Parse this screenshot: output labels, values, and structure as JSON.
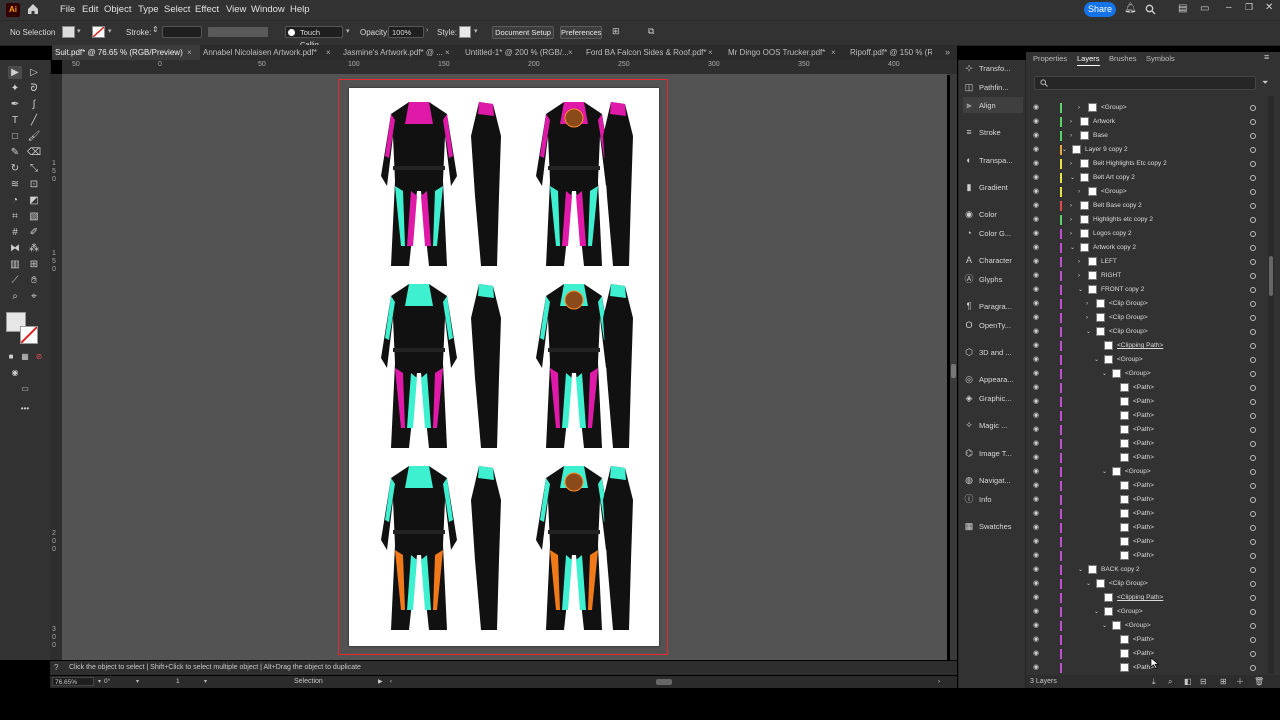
{
  "menu": [
    "File",
    "Edit",
    "Object",
    "Type",
    "Select",
    "Effect",
    "View",
    "Window",
    "Help"
  ],
  "app_logo": "Ai",
  "share_label": "Share",
  "control": {
    "selection": "No Selection",
    "stroke_label": "Stroke:",
    "brush": "Touch Callig...",
    "opacity_label": "Opacity:",
    "opacity_value": "100%",
    "style_label": "Style:",
    "doc_setup": "Document Setup",
    "preferences": "Preferences"
  },
  "tabs": [
    {
      "label": "Suit.pdf* @ 76.65 % (RGB/Preview)"
    },
    {
      "label": "Annabel Nicolaisen Artwork.pdf*"
    },
    {
      "label": "Jasmine's Artwork.pdf* @ ..."
    },
    {
      "label": "Untitled-1* @ 200 % (RGB/..."
    },
    {
      "label": "Ford BA Falcon Sides & Roof.pdf*"
    },
    {
      "label": "Mr Dingo OOS Trucker.pdf*"
    },
    {
      "label": "Ripoff.pdf* @ 150 % (R"
    }
  ],
  "ruler_top": [
    "50",
    "0",
    "50",
    "100",
    "150",
    "200",
    "250",
    "300",
    "350",
    "400",
    "450"
  ],
  "ruler_left": [
    "1",
    "5",
    "0",
    "1",
    "5",
    "0",
    "2",
    "0",
    "0",
    "2",
    "5",
    "0",
    "3",
    "0",
    "0"
  ],
  "status_hint": "Click the object to select  |  Shift+Click to select multiple object  |  Alt+Drag the object to duplicate",
  "bottom": {
    "zoom": "76.65%",
    "rotation": "0°",
    "artboard": "1",
    "mode": "Selection"
  },
  "side_panels": [
    {
      "label": "Transfo...",
      "icon": "transform-icon"
    },
    {
      "label": "Pathfin...",
      "icon": "pathfinder-icon"
    },
    {
      "label": "Align",
      "icon": "align-icon"
    },
    {
      "label": "Stroke",
      "icon": "stroke-icon"
    },
    {
      "label": "Transpa...",
      "icon": "transparency-icon"
    },
    {
      "label": "Gradient",
      "icon": "gradient-icon"
    },
    {
      "label": "Color",
      "icon": "color-icon"
    },
    {
      "label": "Color G...",
      "icon": "color-guide-icon"
    },
    {
      "label": "Character",
      "icon": "character-icon"
    },
    {
      "label": "Glyphs",
      "icon": "glyphs-icon"
    },
    {
      "label": "Paragra...",
      "icon": "paragraph-icon"
    },
    {
      "label": "OpenTy...",
      "icon": "opentype-icon"
    },
    {
      "label": "3D and ...",
      "icon": "3d-icon"
    },
    {
      "label": "Appeara...",
      "icon": "appearance-icon"
    },
    {
      "label": "Graphic...",
      "icon": "graphic-styles-icon"
    },
    {
      "label": "Magic ...",
      "icon": "magic-wand-icon"
    },
    {
      "label": "Image T...",
      "icon": "image-trace-icon"
    },
    {
      "label": "Navigat...",
      "icon": "navigator-icon"
    },
    {
      "label": "Info",
      "icon": "info-icon"
    },
    {
      "label": "Swatches",
      "icon": "swatches-icon"
    }
  ],
  "panel_tabs": [
    "Properties",
    "Layers",
    "Brushes",
    "Symbols"
  ],
  "layers": [
    {
      "name": "<Group>",
      "indent": 5,
      "chev": ">",
      "color": "#5ad266"
    },
    {
      "name": "Artwork",
      "indent": 4,
      "chev": ">",
      "color": "#5ad266"
    },
    {
      "name": "Base",
      "indent": 4,
      "chev": ">",
      "color": "#5ad266"
    },
    {
      "name": "Layer 9 copy 2",
      "indent": 3,
      "chev": "v",
      "color": "#e8a642"
    },
    {
      "name": "Belt Highlights Etc copy 2",
      "indent": 4,
      "chev": ">",
      "color": "#e8e24a"
    },
    {
      "name": "Belt Art copy 2",
      "indent": 4,
      "chev": "v",
      "color": "#e8e24a"
    },
    {
      "name": "<Group>",
      "indent": 5,
      "chev": ">",
      "color": "#e8e24a"
    },
    {
      "name": "Belt Base copy 2",
      "indent": 4,
      "chev": ">",
      "color": "#e04a4a"
    },
    {
      "name": "Highlights etc copy 2",
      "indent": 4,
      "chev": ">",
      "color": "#5ad266"
    },
    {
      "name": "Logos copy 2",
      "indent": 4,
      "chev": ">",
      "color": "#c050d0"
    },
    {
      "name": "Artwork copy 2",
      "indent": 4,
      "chev": "v",
      "color": "#c050d0"
    },
    {
      "name": "LEFT",
      "indent": 5,
      "chev": ">",
      "color": "#c050d0"
    },
    {
      "name": "RIGHT",
      "indent": 5,
      "chev": ">",
      "color": "#c050d0"
    },
    {
      "name": "FRONT copy 2",
      "indent": 5,
      "chev": "v",
      "color": "#c050d0"
    },
    {
      "name": "<Clip Group>",
      "indent": 6,
      "chev": ">",
      "color": "#c050d0"
    },
    {
      "name": "<Clip Group>",
      "indent": 6,
      "chev": ">",
      "color": "#c050d0"
    },
    {
      "name": "<Clip Group>",
      "indent": 6,
      "chev": "v",
      "color": "#c050d0"
    },
    {
      "name": "<Clipping Path>",
      "indent": 7,
      "chev": "",
      "color": "#c050d0",
      "u": true
    },
    {
      "name": "<Group>",
      "indent": 7,
      "chev": "v",
      "color": "#c050d0"
    },
    {
      "name": "<Group>",
      "indent": 8,
      "chev": "v",
      "color": "#c050d0"
    },
    {
      "name": "<Path>",
      "indent": 9,
      "chev": "",
      "color": "#c050d0"
    },
    {
      "name": "<Path>",
      "indent": 9,
      "chev": "",
      "color": "#c050d0"
    },
    {
      "name": "<Path>",
      "indent": 9,
      "chev": "",
      "color": "#c050d0"
    },
    {
      "name": "<Path>",
      "indent": 9,
      "chev": "",
      "color": "#c050d0"
    },
    {
      "name": "<Path>",
      "indent": 9,
      "chev": "",
      "color": "#c050d0"
    },
    {
      "name": "<Path>",
      "indent": 9,
      "chev": "",
      "color": "#c050d0"
    },
    {
      "name": "<Group>",
      "indent": 8,
      "chev": "v",
      "color": "#c050d0"
    },
    {
      "name": "<Path>",
      "indent": 9,
      "chev": "",
      "color": "#c050d0"
    },
    {
      "name": "<Path>",
      "indent": 9,
      "chev": "",
      "color": "#c050d0"
    },
    {
      "name": "<Path>",
      "indent": 9,
      "chev": "",
      "color": "#c050d0"
    },
    {
      "name": "<Path>",
      "indent": 9,
      "chev": "",
      "color": "#c050d0"
    },
    {
      "name": "<Path>",
      "indent": 9,
      "chev": "",
      "color": "#c050d0"
    },
    {
      "name": "<Path>",
      "indent": 9,
      "chev": "",
      "color": "#c050d0"
    },
    {
      "name": "BACK copy 2",
      "indent": 5,
      "chev": "v",
      "color": "#c050d0"
    },
    {
      "name": "<Clip Group>",
      "indent": 6,
      "chev": "v",
      "color": "#c050d0"
    },
    {
      "name": "<Clipping Path>",
      "indent": 7,
      "chev": "",
      "color": "#c050d0",
      "u": true
    },
    {
      "name": "<Group>",
      "indent": 7,
      "chev": "v",
      "color": "#c050d0"
    },
    {
      "name": "<Group>",
      "indent": 8,
      "chev": "v",
      "color": "#c050d0"
    },
    {
      "name": "<Path>",
      "indent": 9,
      "chev": "",
      "color": "#c050d0"
    },
    {
      "name": "<Path>",
      "indent": 9,
      "chev": "",
      "color": "#c050d0"
    },
    {
      "name": "<Path>",
      "indent": 9,
      "chev": "",
      "color": "#c050d0"
    }
  ],
  "layers_count": "3 Layers",
  "suit_rows": [
    {
      "primary": "#e01aa8",
      "secondary": "#3ef0d0"
    },
    {
      "primary": "#3ef0d0",
      "secondary": "#e01aa8"
    },
    {
      "primary": "#3ef0d0",
      "secondary": "#f07a1a"
    }
  ]
}
